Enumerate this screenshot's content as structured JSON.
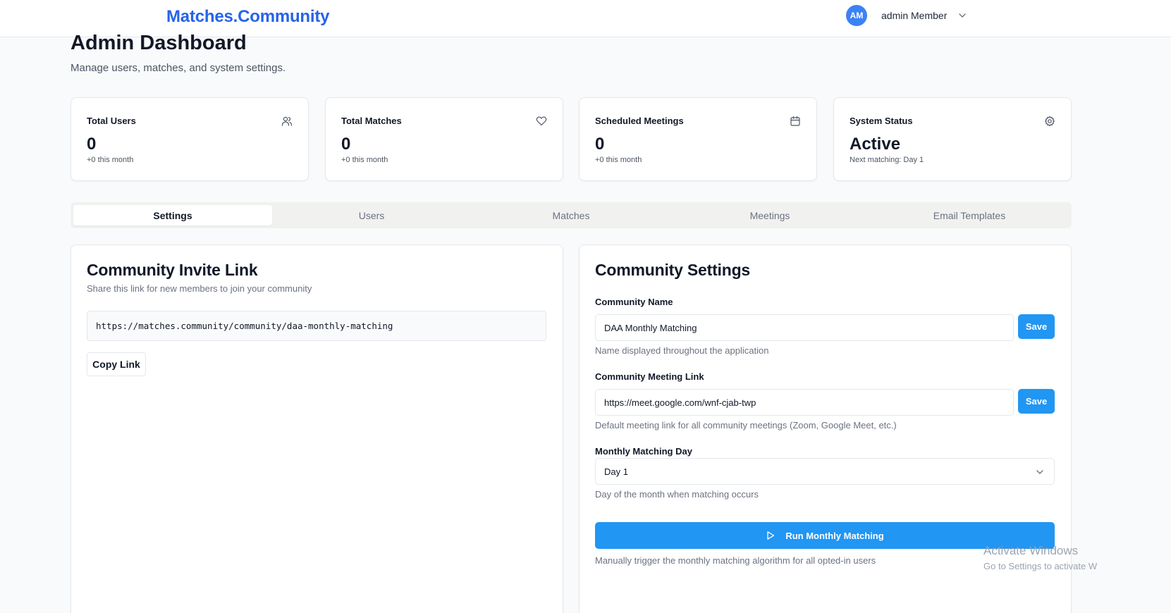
{
  "header": {
    "brand": "Matches.Community",
    "user_initials": "AM",
    "user_name": "admin Member"
  },
  "page": {
    "title": "Admin Dashboard",
    "subtitle": "Manage users, matches, and system settings."
  },
  "stats": [
    {
      "label": "Total Users",
      "value": "0",
      "note": "+0 this month",
      "icon": "users-icon"
    },
    {
      "label": "Total Matches",
      "value": "0",
      "note": "+0 this month",
      "icon": "heart-icon"
    },
    {
      "label": "Scheduled Meetings",
      "value": "0",
      "note": "+0 this month",
      "icon": "calendar-icon"
    },
    {
      "label": "System Status",
      "value": "Active",
      "note": "Next matching: Day 1",
      "icon": "gear-icon"
    }
  ],
  "tabs": [
    {
      "label": "Settings",
      "active": true
    },
    {
      "label": "Users",
      "active": false
    },
    {
      "label": "Matches",
      "active": false
    },
    {
      "label": "Meetings",
      "active": false
    },
    {
      "label": "Email Templates",
      "active": false
    }
  ],
  "invite": {
    "title": "Community Invite Link",
    "description": "Share this link for new members to join your community",
    "link": "https://matches.community/community/daa-monthly-matching",
    "copy_label": "Copy Link"
  },
  "settings": {
    "title": "Community Settings",
    "name_label": "Community Name",
    "name_value": "DAA Monthly Matching",
    "name_help": "Name displayed throughout the application",
    "meeting_label": "Community Meeting Link",
    "meeting_value": "https://meet.google.com/wnf-cjab-twp",
    "meeting_help": "Default meeting link for all community meetings (Zoom, Google Meet, etc.)",
    "save_label": "Save",
    "day_label": "Monthly Matching Day",
    "day_value": "Day 1",
    "day_help": "Day of the month when matching occurs",
    "run_label": "Run Monthly Matching",
    "run_help": "Manually trigger the monthly matching algorithm for all opted-in users"
  },
  "watermark": {
    "line1": "Activate Windows",
    "line2": "Go to Settings to activate W"
  },
  "colors": {
    "brand": "#2563eb",
    "primary_button": "#2196f3",
    "avatar": "#3b82f6"
  }
}
